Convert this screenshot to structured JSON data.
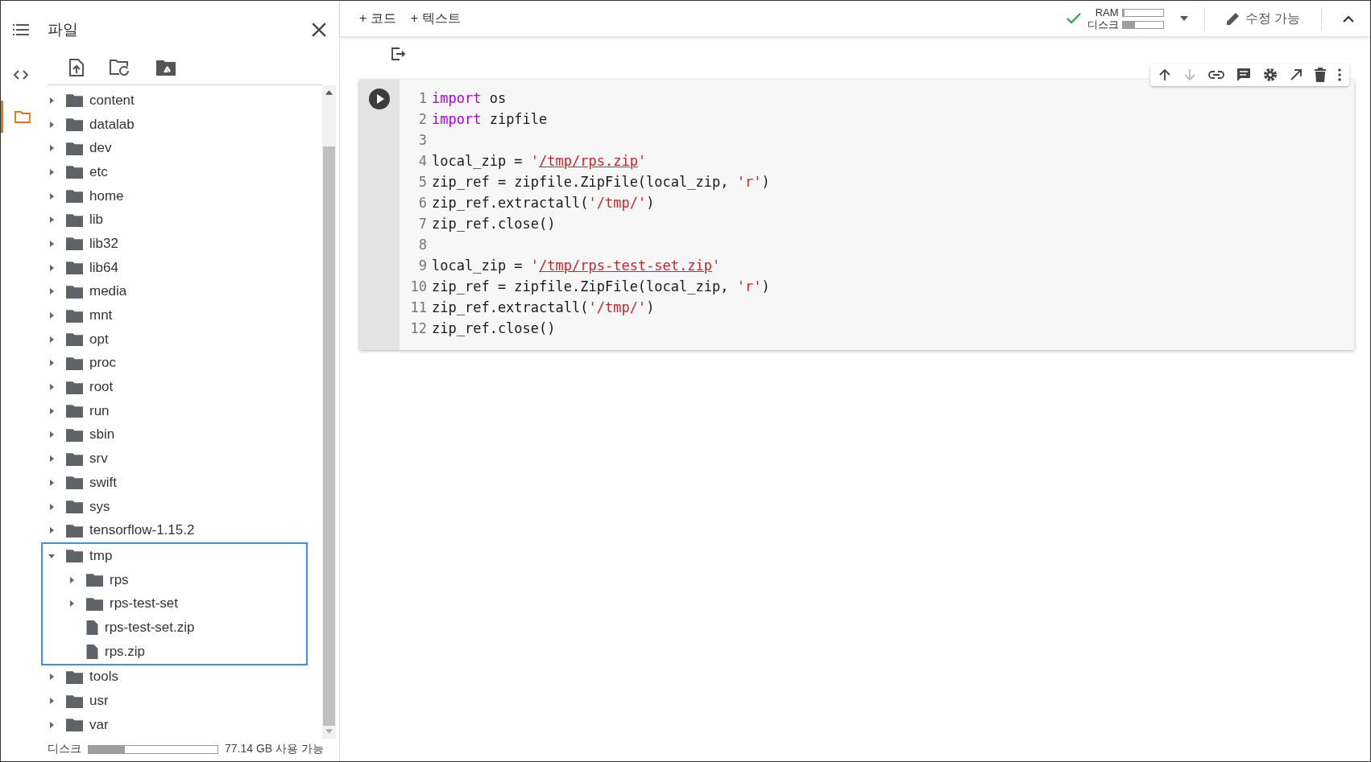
{
  "sidebar": {
    "title": "파일",
    "tree": [
      {
        "name": "content",
        "kind": "folder",
        "expanded": false,
        "highlighted": false
      },
      {
        "name": "datalab",
        "kind": "folder",
        "expanded": false,
        "highlighted": false
      },
      {
        "name": "dev",
        "kind": "folder",
        "expanded": false,
        "highlighted": false
      },
      {
        "name": "etc",
        "kind": "folder",
        "expanded": false,
        "highlighted": false
      },
      {
        "name": "home",
        "kind": "folder",
        "expanded": false,
        "highlighted": false
      },
      {
        "name": "lib",
        "kind": "folder",
        "expanded": false,
        "highlighted": false
      },
      {
        "name": "lib32",
        "kind": "folder",
        "expanded": false,
        "highlighted": false
      },
      {
        "name": "lib64",
        "kind": "folder",
        "expanded": false,
        "highlighted": false
      },
      {
        "name": "media",
        "kind": "folder",
        "expanded": false,
        "highlighted": false
      },
      {
        "name": "mnt",
        "kind": "folder",
        "expanded": false,
        "highlighted": false
      },
      {
        "name": "opt",
        "kind": "folder",
        "expanded": false,
        "highlighted": false
      },
      {
        "name": "proc",
        "kind": "folder",
        "expanded": false,
        "highlighted": false
      },
      {
        "name": "root",
        "kind": "folder",
        "expanded": false,
        "highlighted": false
      },
      {
        "name": "run",
        "kind": "folder",
        "expanded": false,
        "highlighted": false
      },
      {
        "name": "sbin",
        "kind": "folder",
        "expanded": false,
        "highlighted": false
      },
      {
        "name": "srv",
        "kind": "folder",
        "expanded": false,
        "highlighted": false
      },
      {
        "name": "swift",
        "kind": "folder",
        "expanded": false,
        "highlighted": false
      },
      {
        "name": "sys",
        "kind": "folder",
        "expanded": false,
        "highlighted": false
      },
      {
        "name": "tensorflow-1.15.2",
        "kind": "folder",
        "expanded": false,
        "highlighted": false
      },
      {
        "name": "tmp",
        "kind": "folder",
        "expanded": true,
        "highlighted": true,
        "children": [
          {
            "name": "rps",
            "kind": "folder",
            "expanded": false
          },
          {
            "name": "rps-test-set",
            "kind": "folder",
            "expanded": false
          },
          {
            "name": "rps-test-set.zip",
            "kind": "file"
          },
          {
            "name": "rps.zip",
            "kind": "file"
          }
        ]
      },
      {
        "name": "tools",
        "kind": "folder",
        "expanded": false,
        "highlighted": false
      },
      {
        "name": "usr",
        "kind": "folder",
        "expanded": false,
        "highlighted": false
      },
      {
        "name": "var",
        "kind": "folder",
        "expanded": false,
        "highlighted": false
      }
    ],
    "disk": {
      "label": "디스크",
      "level": 0.28,
      "reading": "77.14 GB 사용 가능"
    }
  },
  "toolbar": {
    "add_code": "+ 코드",
    "add_text": "+ 텍스트",
    "ram": {
      "label": "RAM",
      "level": 0.04
    },
    "disk": {
      "label": "디스크",
      "level": 0.3
    },
    "connected": true,
    "edit_mode": "수정 가능"
  },
  "cell": {
    "lines": [
      {
        "number": "1",
        "tokens": [
          {
            "kind": "keyword",
            "text": "import"
          },
          {
            "kind": "plain",
            "text": " os"
          }
        ]
      },
      {
        "number": "2",
        "tokens": [
          {
            "kind": "keyword",
            "text": "import"
          },
          {
            "kind": "plain",
            "text": " zipfile"
          }
        ]
      },
      {
        "number": "3"
      },
      {
        "number": "4",
        "tokens": [
          {
            "kind": "plain",
            "text": "local_zip = "
          },
          {
            "kind": "string",
            "text": "'"
          },
          {
            "kind": "link",
            "text": "/tmp/rps.zip"
          },
          {
            "kind": "string",
            "text": "'"
          }
        ]
      },
      {
        "number": "5",
        "tokens": [
          {
            "kind": "plain",
            "text": "zip_ref = zipfile.ZipFile(local_zip, "
          },
          {
            "kind": "string",
            "text": "'r'"
          },
          {
            "kind": "plain",
            "text": ")"
          }
        ]
      },
      {
        "number": "6",
        "tokens": [
          {
            "kind": "plain",
            "text": "zip_ref.extractall("
          },
          {
            "kind": "string",
            "text": "'/tmp/'"
          },
          {
            "kind": "plain",
            "text": ")"
          }
        ]
      },
      {
        "number": "7",
        "tokens": [
          {
            "kind": "plain",
            "text": "zip_ref.close()"
          }
        ]
      },
      {
        "number": "8"
      },
      {
        "number": "9",
        "tokens": [
          {
            "kind": "plain",
            "text": "local_zip = "
          },
          {
            "kind": "string",
            "text": "'"
          },
          {
            "kind": "link",
            "text": "/tmp/rps-test-set.zip"
          },
          {
            "kind": "string",
            "text": "'"
          }
        ]
      },
      {
        "number": "10",
        "tokens": [
          {
            "kind": "plain",
            "text": "zip_ref = zipfile.ZipFile(local_zip, "
          },
          {
            "kind": "string",
            "text": "'r'"
          },
          {
            "kind": "plain",
            "text": ")"
          }
        ]
      },
      {
        "number": "11",
        "tokens": [
          {
            "kind": "plain",
            "text": "zip_ref.extractall("
          },
          {
            "kind": "string",
            "text": "'/tmp/'"
          },
          {
            "kind": "plain",
            "text": ")"
          }
        ]
      },
      {
        "number": "12",
        "tokens": [
          {
            "kind": "plain",
            "text": "zip_ref.close()"
          }
        ]
      }
    ]
  }
}
